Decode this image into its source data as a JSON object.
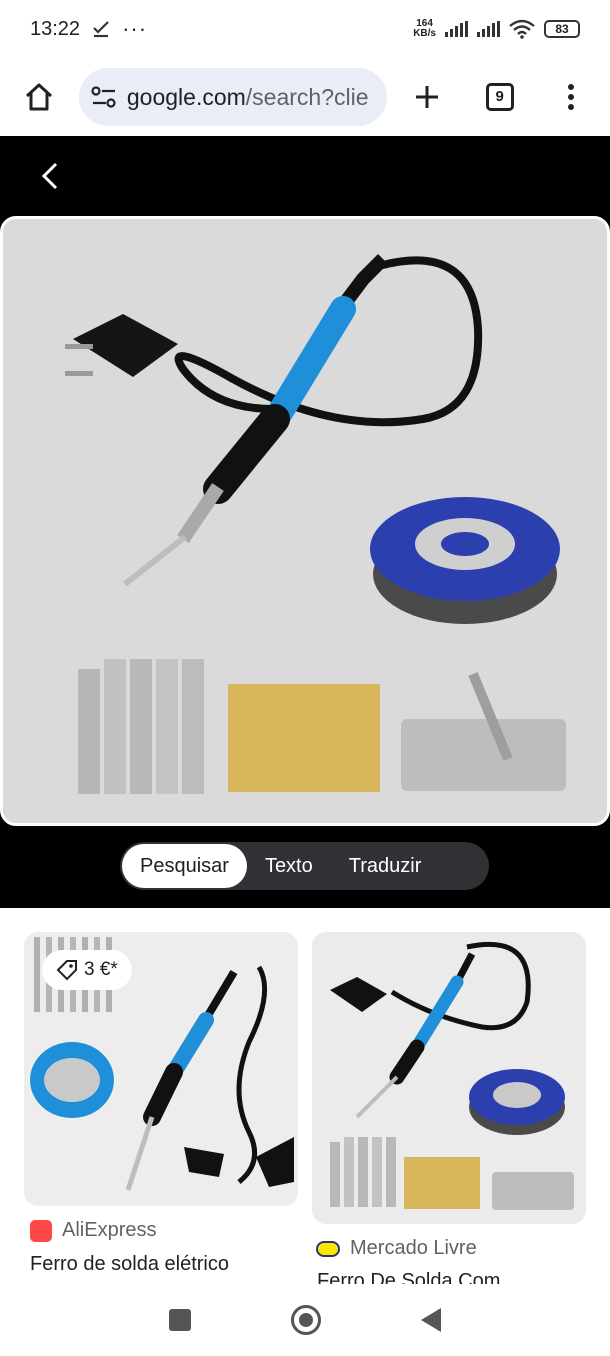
{
  "status_bar": {
    "time": "13:22",
    "net_speed_value": "164",
    "net_speed_unit": "KB/s",
    "battery": "83"
  },
  "browser": {
    "url_host": "google.com",
    "url_path": "/search?clie",
    "tab_count": "9"
  },
  "lens": {
    "tabs": [
      {
        "label": "Pesquisar",
        "active": true
      },
      {
        "label": "Texto",
        "active": false
      },
      {
        "label": "Traduzir",
        "active": false
      }
    ]
  },
  "results": [
    {
      "price": "3 €*",
      "source": "AliExpress",
      "title": "Ferro de solda elétrico"
    },
    {
      "source": "Mercado Livre",
      "title": "Ferro De Solda Com"
    }
  ],
  "colors": {
    "accent_blue": "#1e8fd8",
    "spool_blue": "#2b3fae",
    "sponge": "#d8b65c",
    "aliexpress": "#ff4747"
  }
}
